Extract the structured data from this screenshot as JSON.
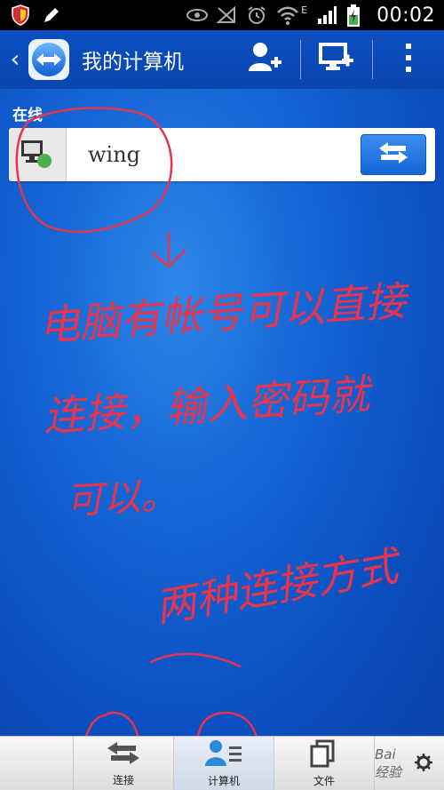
{
  "status_bar": {
    "time": "00:02",
    "network_label": "E"
  },
  "action_bar": {
    "title": "我的计算机"
  },
  "section": {
    "label": "在线"
  },
  "devices": [
    {
      "name": "wing"
    }
  ],
  "annotations": {
    "line1": "电脑有帐号可以直接",
    "line2": "连接，输入密码就",
    "line3": "可以。",
    "line4": "两种连接方式"
  },
  "tabbar": {
    "tabs": [
      {
        "label": "连接"
      },
      {
        "label": "计算机"
      },
      {
        "label": "文件"
      }
    ]
  },
  "watermark": "Bai经验",
  "colors": {
    "status_bar": "#000000",
    "action_bar": "#0c4fc0",
    "main_bg": "#1566d5",
    "accent_button": "#1366d6",
    "online_dot": "#4caf50",
    "annotation_ink": "#e8344c"
  }
}
